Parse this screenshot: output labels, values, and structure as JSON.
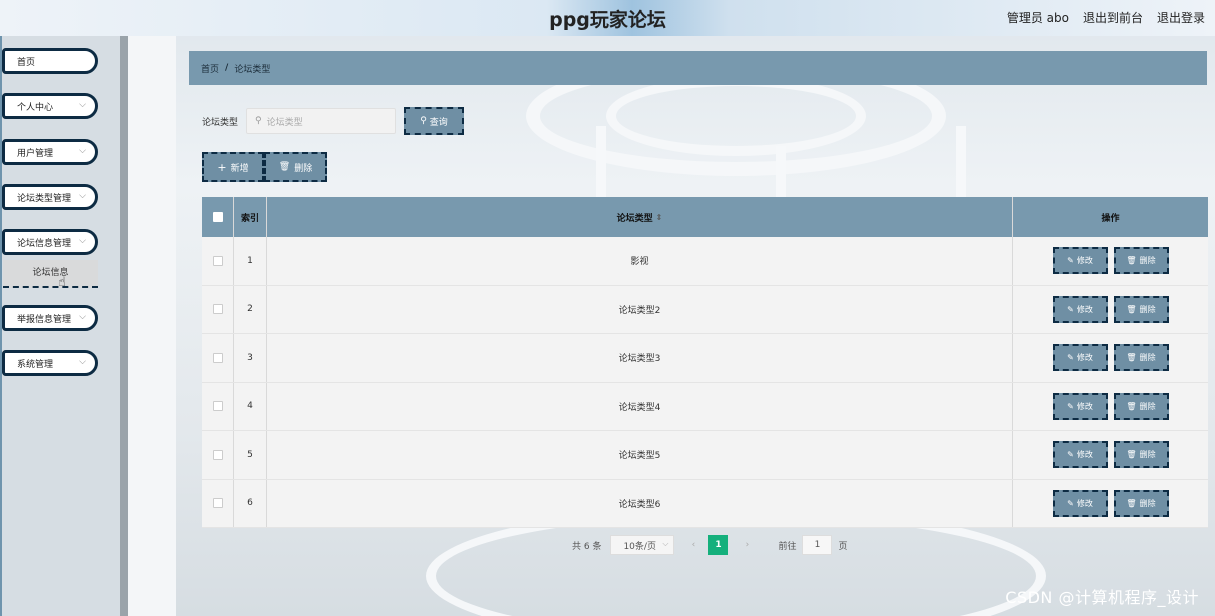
{
  "header": {
    "title": "ppg玩家论坛",
    "user": "管理员 abo",
    "to_front": "退出到前台",
    "logout": "退出登录"
  },
  "sidebar": {
    "items": [
      {
        "label": "首页",
        "icon": "none"
      },
      {
        "label": "个人中心",
        "icon": "chevron-down-icon"
      },
      {
        "label": "用户管理",
        "icon": "chevron-down-icon"
      },
      {
        "label": "论坛类型管理",
        "icon": "chevron-down-icon"
      },
      {
        "label": "论坛信息管理",
        "icon": "chevron-down-icon"
      },
      {
        "label": "举报信息管理",
        "icon": "chevron-down-icon"
      },
      {
        "label": "系统管理",
        "icon": "chevron-down-icon"
      }
    ],
    "submenu_item": "论坛信息"
  },
  "breadcrumb": {
    "home": "首页",
    "separator": "/",
    "current": "论坛类型"
  },
  "search": {
    "label": "论坛类型",
    "placeholder": "论坛类型",
    "button": "查询"
  },
  "actions": {
    "add": "新增",
    "delete": "删除"
  },
  "table": {
    "headers": {
      "index": "索引",
      "type": "论坛类型",
      "ops": "操作"
    },
    "rows": [
      {
        "index": "1",
        "type": "影视"
      },
      {
        "index": "2",
        "type": "论坛类型2"
      },
      {
        "index": "3",
        "type": "论坛类型3"
      },
      {
        "index": "4",
        "type": "论坛类型4"
      },
      {
        "index": "5",
        "type": "论坛类型5"
      },
      {
        "index": "6",
        "type": "论坛类型6"
      }
    ],
    "edit_label": "修改",
    "delete_label": "删除"
  },
  "pager": {
    "total": "共 6 条",
    "page_size": "10条/页",
    "current_page": "1",
    "goto_label": "前往",
    "goto_value": "1",
    "goto_unit": "页"
  },
  "watermark": "CSDN @计算机程序_设计",
  "colors": {
    "accent_bar": "#7899ae",
    "button_border": "#0d2b43",
    "active_page": "#15b07c"
  }
}
